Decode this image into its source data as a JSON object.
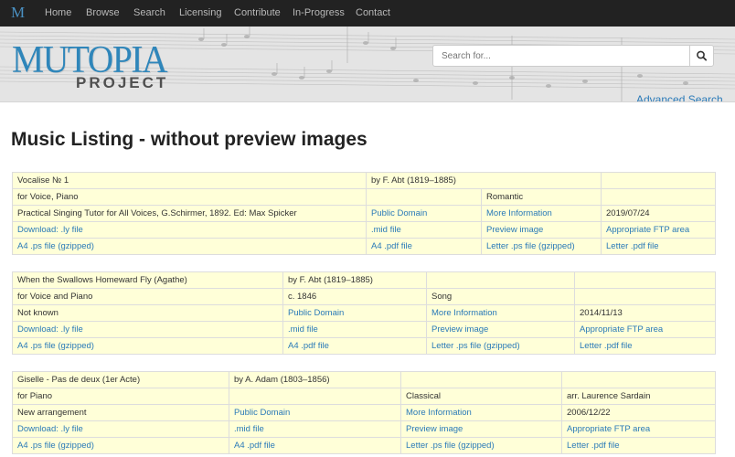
{
  "nav": {
    "brand": "M",
    "items": [
      "Home",
      "Browse",
      "Search",
      "Licensing",
      "Contribute",
      "In-Progress",
      "Contact"
    ]
  },
  "header": {
    "logo_main": "MUTOPIA",
    "logo_sub": "PROJECT",
    "search_placeholder": "Search for...",
    "advanced_search": "Advanced Search"
  },
  "page_title": "Music Listing - without preview images",
  "entries": [
    {
      "title": "Vocalise № 1",
      "composer": "by F. Abt (1819–1885)",
      "instruments": "for Voice, Piano",
      "date": "",
      "style": "Romantic",
      "arranger": "",
      "source": "Practical Singing Tutor for All Voices, G.Schirmer, 1892. Ed: Max Spicker",
      "license": "Public Domain",
      "more_info": "More Information",
      "updated": "2019/07/24",
      "download_ly": "Download: .ly file",
      "mid": ".mid file",
      "preview": "Preview image",
      "ftp": "Appropriate FTP area",
      "a4_ps": "A4 .ps file (gzipped)",
      "a4_pdf": "A4 .pdf file",
      "letter_ps": "Letter .ps file (gzipped)",
      "letter_pdf": "Letter .pdf file"
    },
    {
      "title": "When the Swallows Homeward Fly (Agathe)",
      "composer": "by F. Abt (1819–1885)",
      "instruments": "for Voice and Piano",
      "date": "c. 1846",
      "style": "Song",
      "arranger": "",
      "source": "Not known",
      "license": "Public Domain",
      "more_info": "More Information",
      "updated": "2014/11/13",
      "download_ly": "Download: .ly file",
      "mid": ".mid file",
      "preview": "Preview image",
      "ftp": "Appropriate FTP area",
      "a4_ps": "A4 .ps file (gzipped)",
      "a4_pdf": "A4 .pdf file",
      "letter_ps": "Letter .ps file (gzipped)",
      "letter_pdf": "Letter .pdf file"
    },
    {
      "title": "Giselle - Pas de deux (1er Acte)",
      "composer": "by A. Adam (1803–1856)",
      "instruments": "for Piano",
      "date": "",
      "style": "Classical",
      "arranger": "arr. Laurence Sardain",
      "source": "New arrangement",
      "license": "Public Domain",
      "more_info": "More Information",
      "updated": "2006/12/22",
      "download_ly": "Download: .ly file",
      "mid": ".mid file",
      "preview": "Preview image",
      "ftp": "Appropriate FTP area",
      "a4_ps": "A4 .ps file (gzipped)",
      "a4_pdf": "A4 .pdf file",
      "letter_ps": "Letter .ps file (gzipped)",
      "letter_pdf": "Letter .pdf file"
    }
  ]
}
